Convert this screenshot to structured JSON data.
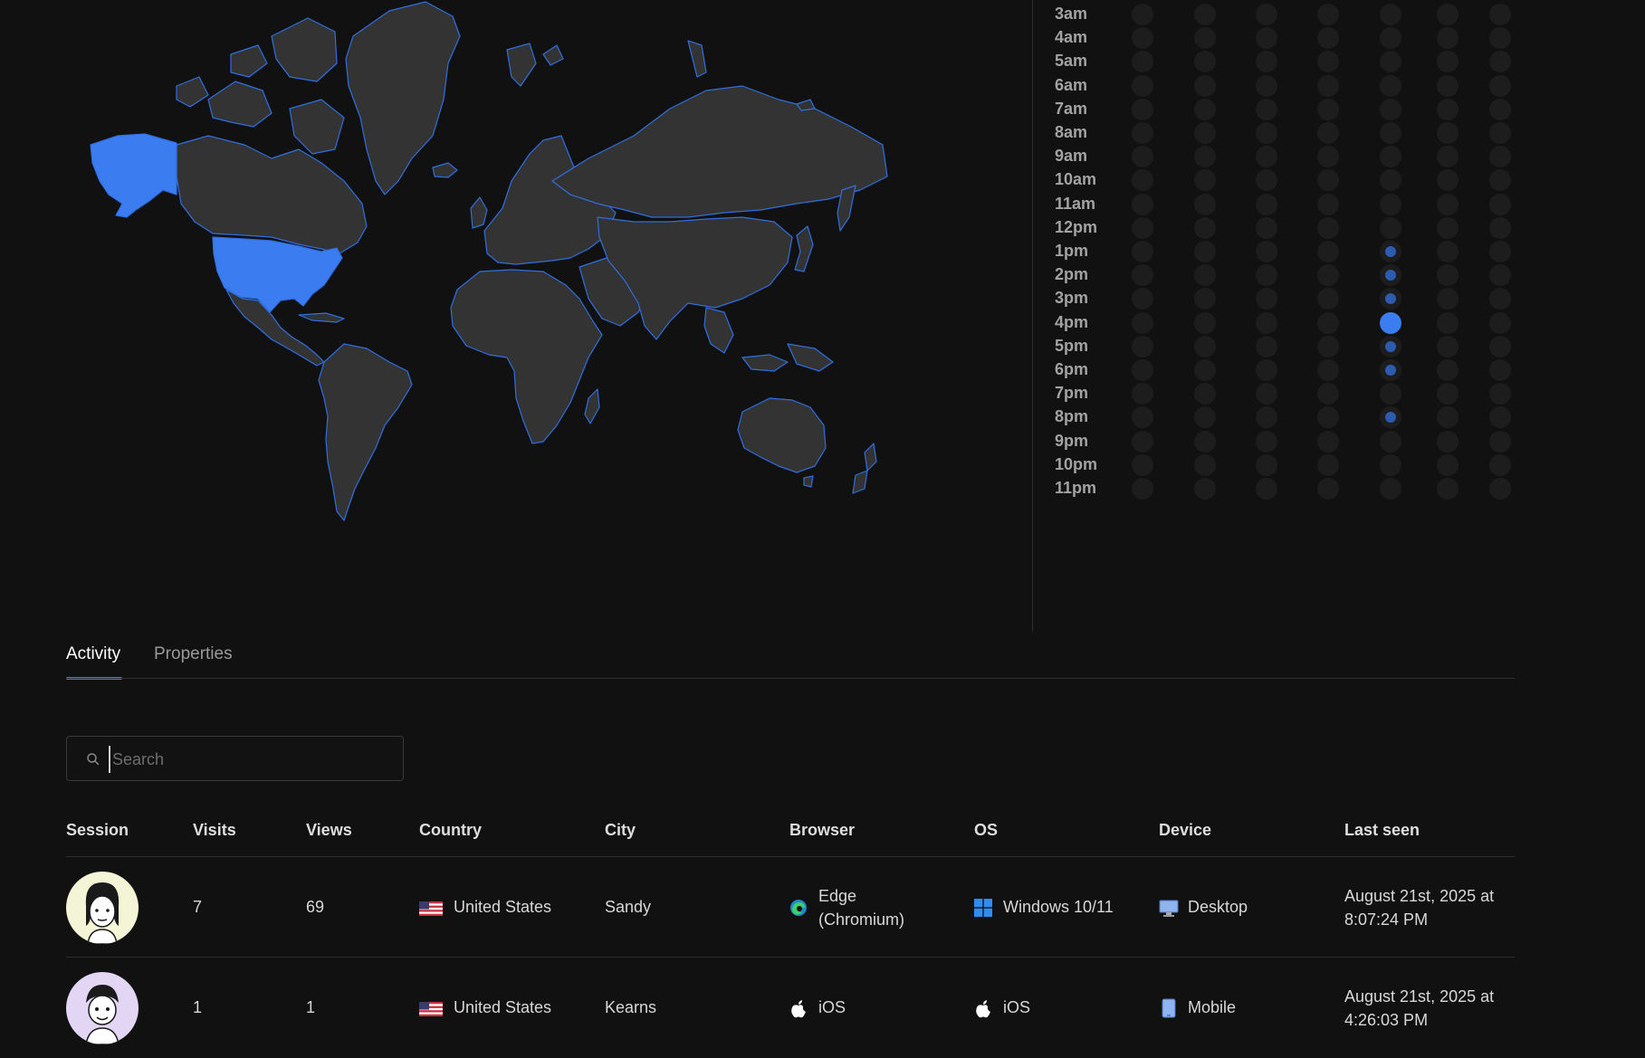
{
  "tabs": {
    "activity": "Activity",
    "properties": "Properties"
  },
  "search": {
    "placeholder": "Search"
  },
  "heatmap": {
    "hours": [
      "3am",
      "4am",
      "5am",
      "6am",
      "7am",
      "8am",
      "9am",
      "10am",
      "11am",
      "12pm",
      "1pm",
      "2pm",
      "3pm",
      "4pm",
      "5pm",
      "6pm",
      "7pm",
      "8pm",
      "9pm",
      "10pm",
      "11pm"
    ],
    "day_count": 7,
    "active": [
      {
        "hour": "1pm",
        "day_index": 4,
        "level": 0.25
      },
      {
        "hour": "2pm",
        "day_index": 4,
        "level": 0.25
      },
      {
        "hour": "3pm",
        "day_index": 4,
        "level": 0.25
      },
      {
        "hour": "4pm",
        "day_index": 4,
        "level": 1.0
      },
      {
        "hour": "5pm",
        "day_index": 4,
        "level": 0.25
      },
      {
        "hour": "6pm",
        "day_index": 4,
        "level": 0.25
      },
      {
        "hour": "8pm",
        "day_index": 4,
        "level": 0.25
      }
    ],
    "accent": "#3b7df0"
  },
  "map": {
    "highlighted_countries": [
      "United States"
    ],
    "highlight_color": "#3b7df0",
    "land_color": "#333333",
    "border_color": "#2f6fe0"
  },
  "table": {
    "headers": {
      "session": "Session",
      "visits": "Visits",
      "views": "Views",
      "country": "Country",
      "city": "City",
      "browser": "Browser",
      "os": "OS",
      "device": "Device",
      "last_seen": "Last seen"
    },
    "rows": [
      {
        "avatar_bg": "#f4f5d6",
        "visits": "7",
        "views": "69",
        "country": "United States",
        "country_icon": "us-flag-icon",
        "city": "Sandy",
        "browser_line1": "Edge",
        "browser_line2": "(Chromium)",
        "browser_icon": "edge-icon",
        "os": "Windows 10/11",
        "os_icon": "windows-icon",
        "device": "Desktop",
        "device_icon": "desktop-icon",
        "last_seen_line1": "August 21st, 2025 at",
        "last_seen_line2": "8:07:24 PM"
      },
      {
        "avatar_bg": "#e2d6f4",
        "visits": "1",
        "views": "1",
        "country": "United States",
        "country_icon": "us-flag-icon",
        "city": "Kearns",
        "browser_line1": "iOS",
        "browser_line2": "",
        "browser_icon": "apple-icon",
        "os": "iOS",
        "os_icon": "apple-icon",
        "device": "Mobile",
        "device_icon": "mobile-icon",
        "last_seen_line1": "August 21st, 2025 at",
        "last_seen_line2": "4:26:03 PM"
      }
    ]
  }
}
